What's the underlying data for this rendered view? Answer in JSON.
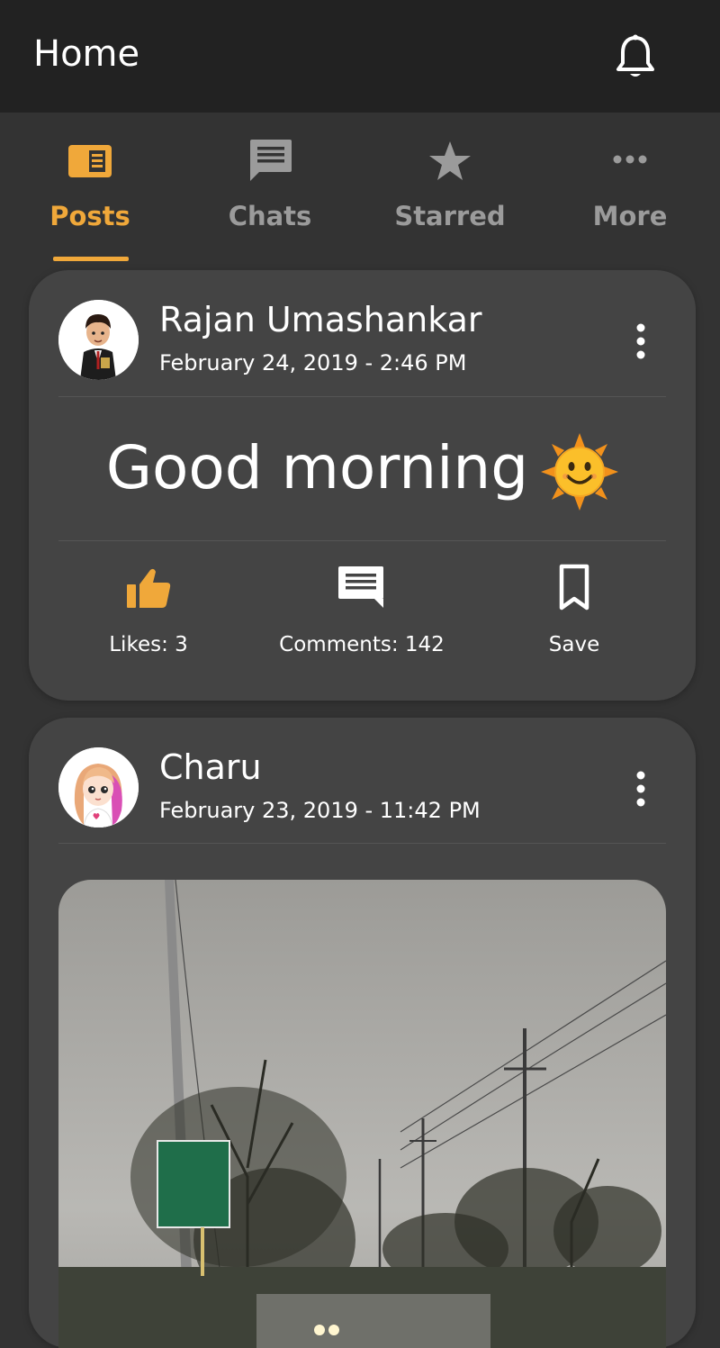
{
  "appbar": {
    "title": "Home",
    "icon": "bell-icon"
  },
  "tabs": [
    {
      "label": "Posts",
      "icon": "news-icon",
      "active": true
    },
    {
      "label": "Chats",
      "icon": "chat-icon",
      "active": false
    },
    {
      "label": "Starred",
      "icon": "star-icon",
      "active": false
    },
    {
      "label": "More",
      "icon": "more-horizontal-icon",
      "active": false
    }
  ],
  "posts": [
    {
      "author": "Rajan Umashankar",
      "date": "February 24, 2019 - 2:46 PM",
      "text": "Good morning",
      "emoji": "sun-face-icon",
      "actions": {
        "likes": "Likes: 3",
        "comments": "Comments: 142",
        "save": "Save"
      }
    },
    {
      "author": "Charu",
      "date": "February 23, 2019 - 11:42 PM",
      "image": "road-with-trees-and-power-lines-photo"
    }
  ],
  "colors": {
    "accent": "#f0a83a",
    "appbar": "#222222",
    "background": "#333333",
    "card": "#444444",
    "inactive": "#9b9b9b"
  }
}
